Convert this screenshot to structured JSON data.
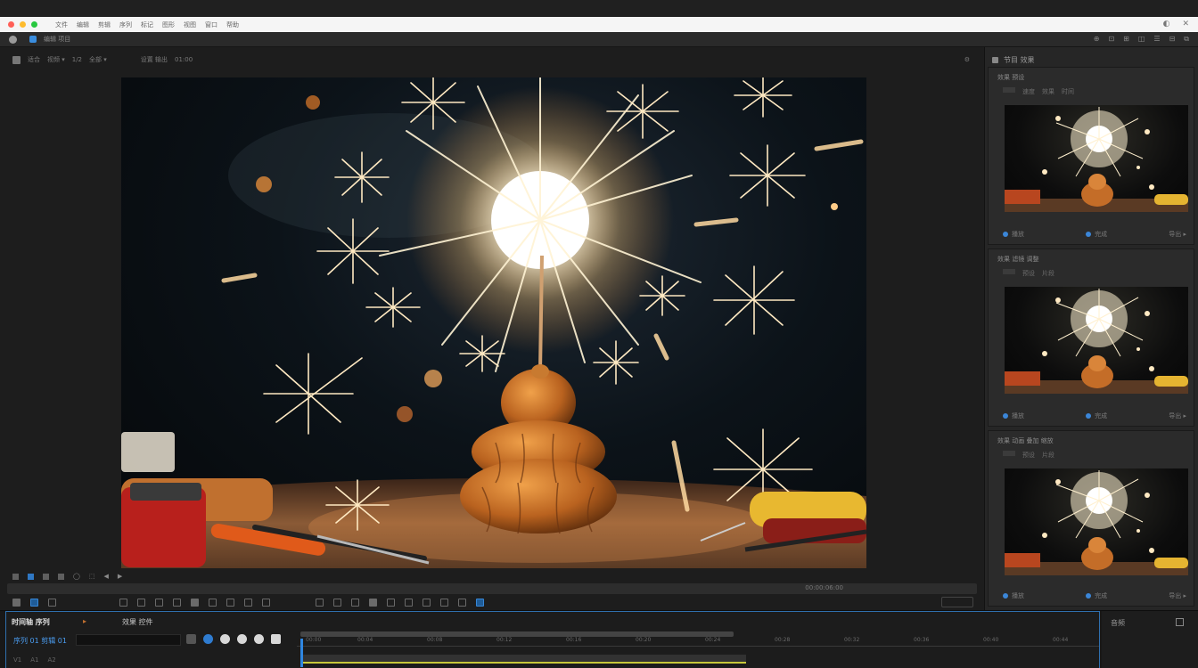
{
  "titlebar": {
    "menu": [
      "文件",
      "编辑",
      "剪辑",
      "序列",
      "标记",
      "图形",
      "视图",
      "窗口",
      "帮助"
    ],
    "right_icons": [
      "◐",
      "✕"
    ]
  },
  "appbar": {
    "title": "编辑 项目",
    "right": [
      "⊕",
      "⊡",
      "⊞",
      "◫",
      "☰",
      "⊟",
      "⧉"
    ]
  },
  "viewer": {
    "toolbar": [
      "适合",
      "视频 ▾",
      "1/2",
      "全部 ▾",
      "设置 输出",
      "01:00"
    ],
    "toolbar_right": "⚙",
    "scrub_value": "00:00:06:00",
    "below_tools": [
      "◯",
      "⬚",
      "◀",
      "▶"
    ]
  },
  "right_panel": {
    "header": "节目 效果",
    "cards": [
      {
        "title": "效果 预设",
        "sub": [
          "速度",
          "效果",
          "时间"
        ],
        "foot_left": "播放",
        "foot_mid": "完成",
        "foot_right": "导出 ▸"
      },
      {
        "title": "效果 滤镜 调整",
        "sub": [
          "预设",
          "片段"
        ],
        "foot_left": "播放",
        "foot_mid": "完成",
        "foot_right": "导出 ▸"
      },
      {
        "title": "效果 动画 叠加 缩放",
        "sub": [
          "预设",
          "片段"
        ],
        "foot_left": "播放",
        "foot_mid": "完成",
        "foot_right": "导出 ▸"
      }
    ]
  },
  "timeline": {
    "tabs": [
      "时间轴 序列",
      "▸",
      "效果 控件"
    ],
    "sequence_name": "序列 01 剪辑 01",
    "ruler_ticks": [
      "00:00",
      "00:04",
      "00:08",
      "00:12",
      "00:16",
      "00:20",
      "00:24",
      "00:28",
      "00:32",
      "00:36",
      "00:40",
      "00:44"
    ],
    "row2": [
      "V1",
      "A1",
      "A2"
    ],
    "right_label": "音频",
    "playhead_time": "00:00"
  },
  "colors": {
    "accent": "#2f86e0",
    "panel": "#262626",
    "bg": "#1b1b1b"
  }
}
